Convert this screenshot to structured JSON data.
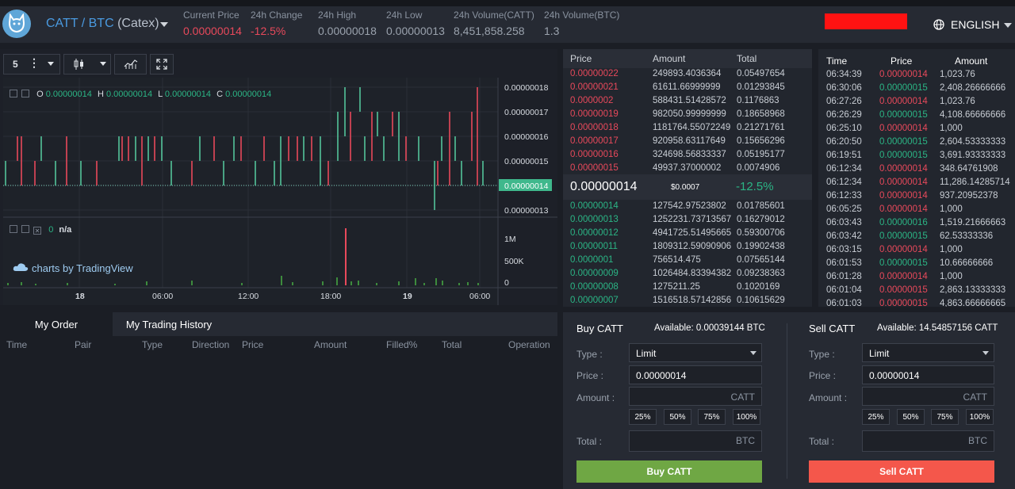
{
  "header": {
    "pair": "CATT / BTC",
    "exchange": "(Catex)",
    "stats": [
      {
        "label": "Current Price",
        "value": "0.00000014",
        "color": "red"
      },
      {
        "label": "24h Change",
        "value": "-12.5%",
        "color": "red"
      },
      {
        "label": "24h High",
        "value": "0.00000018",
        "color": "default"
      },
      {
        "label": "24h Low",
        "value": "0.00000013",
        "color": "default"
      },
      {
        "label": "24h Volume(CATT)",
        "value": "8,451,858.258",
        "color": "default"
      },
      {
        "label": "24h Volume(BTC)",
        "value": "1.3",
        "color": "default"
      }
    ],
    "language": "ENGLISH"
  },
  "chart": {
    "interval": "5",
    "ohlc": {
      "o_label": "O",
      "o": "0.00000014",
      "h_label": "H",
      "h": "0.00000014",
      "l_label": "L",
      "l": "0.00000014",
      "c_label": "C",
      "c": "0.00000014"
    },
    "price_axis": [
      "0.00000018",
      "0.00000017",
      "0.00000016",
      "0.00000015",
      "0.00000014",
      "0.00000013"
    ],
    "current_price_tag": "0.00000014",
    "indicator_value": "0",
    "indicator_na": "n/a",
    "volume_axis": [
      "1M",
      "500K",
      "0"
    ],
    "time_axis": [
      "18",
      "06:00",
      "12:00",
      "18:00",
      "19",
      "06:00"
    ],
    "credit": "charts by TradingView"
  },
  "orderbook": {
    "headers": [
      "Price",
      "Amount",
      "Total"
    ],
    "asks": [
      [
        "0.00000022",
        "249893.4036364",
        "0.05497654"
      ],
      [
        "0.00000021",
        "61611.66999999",
        "0.01293845"
      ],
      [
        "0.0000002",
        "588431.51428572",
        "0.1176863"
      ],
      [
        "0.00000019",
        "982050.99999999",
        "0.18658968"
      ],
      [
        "0.00000018",
        "1181764.55072249",
        "0.21271761"
      ],
      [
        "0.00000017",
        "920958.63117649",
        "0.15656296"
      ],
      [
        "0.00000016",
        "324698.56833337",
        "0.05195177"
      ],
      [
        "0.00000015",
        "49937.37000002",
        "0.0074906"
      ]
    ],
    "mid": {
      "price": "0.00000014",
      "usd": "$0.0007",
      "change": "-12.5%"
    },
    "bids": [
      [
        "0.00000014",
        "127542.97523802",
        "0.01785601"
      ],
      [
        "0.00000013",
        "1252231.73713567",
        "0.16279012"
      ],
      [
        "0.00000012",
        "4941725.51495665",
        "0.59300706"
      ],
      [
        "0.00000011",
        "1809312.59090906",
        "0.19902438"
      ],
      [
        "0.0000001",
        "756514.475",
        "0.07565144"
      ],
      [
        "0.00000009",
        "1026484.83394382",
        "0.09238363"
      ],
      [
        "0.00000008",
        "1275211.25",
        "0.1020169"
      ],
      [
        "0.00000007",
        "1516518.57142856",
        "0.10615629"
      ]
    ]
  },
  "trades": {
    "headers": [
      "Time",
      "Price",
      "Amount"
    ],
    "rows": [
      [
        "06:34:39",
        "0.00000014",
        "1,023.76",
        "red"
      ],
      [
        "06:30:06",
        "0.00000015",
        "2,408.26666666",
        "green"
      ],
      [
        "06:27:26",
        "0.00000014",
        "1,023.76",
        "red"
      ],
      [
        "06:26:29",
        "0.00000015",
        "4,108.66666666",
        "green"
      ],
      [
        "06:25:10",
        "0.00000014",
        "1,000",
        "red"
      ],
      [
        "06:20:50",
        "0.00000015",
        "2,604.53333333",
        "green"
      ],
      [
        "06:19:51",
        "0.00000015",
        "3,691.93333333",
        "green"
      ],
      [
        "06:12:34",
        "0.00000014",
        "348.64761908",
        "red"
      ],
      [
        "06:12:34",
        "0.00000014",
        "11,286.14285714",
        "red"
      ],
      [
        "06:12:33",
        "0.00000014",
        "937.20952378",
        "red"
      ],
      [
        "06:05:25",
        "0.00000014",
        "1,000",
        "red"
      ],
      [
        "06:03:43",
        "0.00000016",
        "1,519.21666663",
        "green"
      ],
      [
        "06:03:42",
        "0.00000015",
        "62.53333336",
        "green"
      ],
      [
        "06:03:15",
        "0.00000014",
        "1,000",
        "red"
      ],
      [
        "06:01:53",
        "0.00000015",
        "10.66666666",
        "green"
      ],
      [
        "06:01:28",
        "0.00000014",
        "1,000",
        "red"
      ],
      [
        "06:01:04",
        "0.00000015",
        "2,863.13333333",
        "red"
      ],
      [
        "06:01:03",
        "0.00000015",
        "4,863.66666665",
        "red"
      ]
    ]
  },
  "orders": {
    "tabs": [
      "My Order",
      "My Trading History"
    ],
    "columns": [
      "Time",
      "Pair",
      "Type",
      "Direction",
      "Price",
      "Amount",
      "Filled%",
      "Total",
      "Operation"
    ]
  },
  "buy": {
    "title": "Buy CATT",
    "available": "Available: 0.00039144 BTC",
    "type_label": "Type :",
    "type_value": "Limit",
    "price_label": "Price :",
    "price_value": "0.00000014",
    "amount_label": "Amount :",
    "amount_unit": "CATT",
    "percents": [
      "25%",
      "50%",
      "75%",
      "100%"
    ],
    "total_label": "Total :",
    "total_unit": "BTC",
    "button": "Buy CATT",
    "button_color": "#6fa744"
  },
  "sell": {
    "title": "Sell CATT",
    "available": "Available: 14.54857156 CATT",
    "type_label": "Type :",
    "type_value": "Limit",
    "price_label": "Price :",
    "price_value": "0.00000014",
    "amount_label": "Amount :",
    "amount_unit": "CATT",
    "percents": [
      "25%",
      "50%",
      "75%",
      "100%"
    ],
    "total_label": "Total :",
    "total_unit": "BTC",
    "button": "Sell CATT",
    "button_color": "#f4574b"
  }
}
